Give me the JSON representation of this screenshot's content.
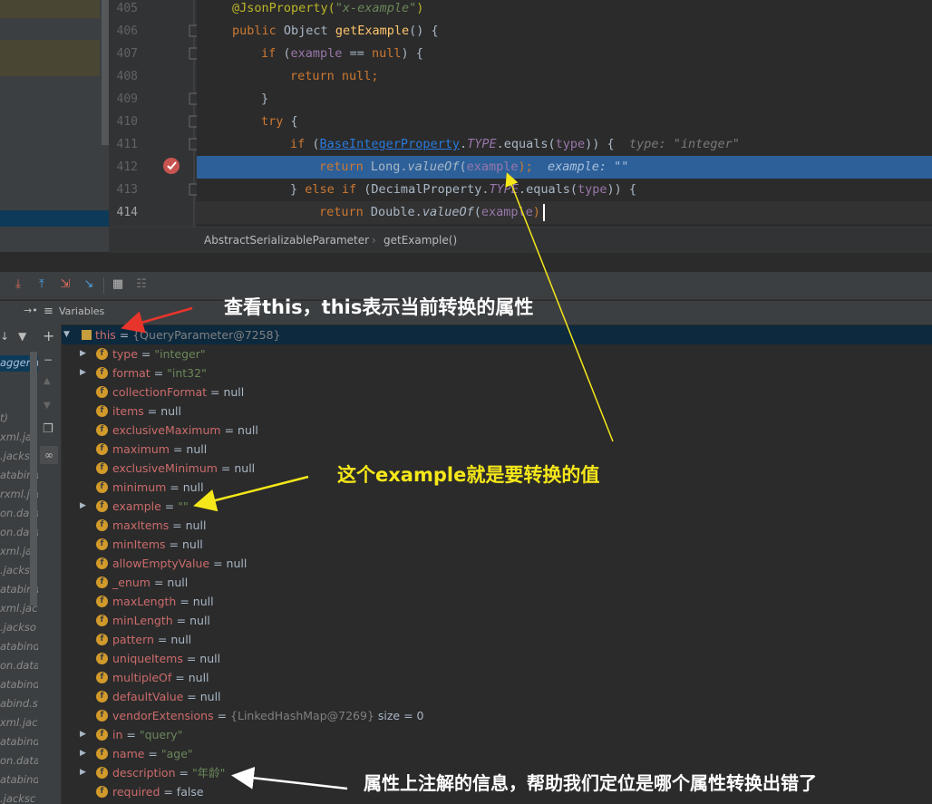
{
  "code": {
    "lines": [
      {
        "num": "405"
      },
      {
        "num": "406"
      },
      {
        "num": "407"
      },
      {
        "num": "408"
      },
      {
        "num": "409"
      },
      {
        "num": "410"
      },
      {
        "num": "411"
      },
      {
        "num": "412"
      },
      {
        "num": "413"
      },
      {
        "num": "414"
      }
    ],
    "l405": {
      "ann": "@JsonProperty(",
      "str": "\"x-example\"",
      "close": ")"
    },
    "l406": {
      "kw": "public ",
      "type": "Object ",
      "fn": "getExample",
      "rest": "() {"
    },
    "l407": {
      "kw": "if ",
      "rest1": "(",
      "field": "example",
      "rest2": " == ",
      "kw2": "null",
      "rest3": ") {"
    },
    "l408": {
      "kw": "return ",
      "kw2": "null",
      "rest": ";"
    },
    "l409": {
      "rest": "}"
    },
    "l410": {
      "kw": "try ",
      "rest": "{"
    },
    "l411": {
      "kw": "if ",
      "rest1": "(",
      "link": "BaseIntegerProperty",
      "dot": ".",
      "const": "TYPE",
      "rest2": ".equals(",
      "field": "type",
      "rest3": ")) {",
      "hint": "type: \"integer\""
    },
    "l412": {
      "kw": "return ",
      "cls": "Long.",
      "fn": "valueOf",
      "rest1": "(",
      "field": "example",
      "rest2": ");",
      "hint": "example: \"\""
    },
    "l413": {
      "rest1": "} ",
      "kw": "else if ",
      "rest2": "(DecimalProperty.",
      "const": "TYPE",
      "rest3": ".equals(",
      "field": "type",
      "rest4": ")) {"
    },
    "l414": {
      "kw": "return ",
      "cls": "Double.",
      "fn": "valueOf",
      "rest1": "(",
      "field": "example",
      "rest2": ");"
    }
  },
  "breadcrumb": {
    "class_name": "AbstractSerializableParameter",
    "separator": "›",
    "method": "getExample()"
  },
  "debug": {
    "variables_label": "Variables",
    "toolbar_icons": [
      "step-over-icon",
      "step-into-icon",
      "force-step-into-icon",
      "step-out-icon",
      "run-to-cursor-icon",
      "evaluate-icon",
      "trace-icon"
    ]
  },
  "frames": {
    "items": [
      "agger.m",
      "t)",
      "xml.jacks",
      ".jackso",
      "atabind.",
      "rxml.jac",
      "on.data",
      "on.data",
      "xml.jacks",
      ".jackso",
      "atabind.",
      "xml.jacks",
      ".jackso",
      "atabind.",
      "on.data",
      "atabind.",
      "abind.s",
      "xml.jacks",
      "atabind.",
      "on.data",
      "atabind.",
      ".jacksc"
    ]
  },
  "variables": {
    "this": {
      "name": "this",
      "eq": " = ",
      "value": "{QueryParameter@7258}"
    },
    "rows": [
      {
        "name": "type",
        "eq": " = ",
        "value": "\"integer\"",
        "kind": "str",
        "expand": true
      },
      {
        "name": "format",
        "eq": " = ",
        "value": "\"int32\"",
        "kind": "str",
        "expand": true
      },
      {
        "name": "collectionFormat",
        "eq": " = ",
        "value": "null",
        "kind": "null",
        "expand": false
      },
      {
        "name": "items",
        "eq": " = ",
        "value": "null",
        "kind": "null",
        "expand": false
      },
      {
        "name": "exclusiveMaximum",
        "eq": " = ",
        "value": "null",
        "kind": "null",
        "expand": false
      },
      {
        "name": "maximum",
        "eq": " = ",
        "value": "null",
        "kind": "null",
        "expand": false
      },
      {
        "name": "exclusiveMinimum",
        "eq": " = ",
        "value": "null",
        "kind": "null",
        "expand": false
      },
      {
        "name": "minimum",
        "eq": " = ",
        "value": "null",
        "kind": "null",
        "expand": false
      },
      {
        "name": "example",
        "eq": " = ",
        "value": "\"\"",
        "kind": "str",
        "expand": true
      },
      {
        "name": "maxItems",
        "eq": " = ",
        "value": "null",
        "kind": "null",
        "expand": false
      },
      {
        "name": "minItems",
        "eq": " = ",
        "value": "null",
        "kind": "null",
        "expand": false
      },
      {
        "name": "allowEmptyValue",
        "eq": " = ",
        "value": "null",
        "kind": "null",
        "expand": false
      },
      {
        "name": "_enum",
        "eq": " = ",
        "value": "null",
        "kind": "null",
        "expand": false
      },
      {
        "name": "maxLength",
        "eq": " = ",
        "value": "null",
        "kind": "null",
        "expand": false
      },
      {
        "name": "minLength",
        "eq": " = ",
        "value": "null",
        "kind": "null",
        "expand": false
      },
      {
        "name": "pattern",
        "eq": " = ",
        "value": "null",
        "kind": "null",
        "expand": false
      },
      {
        "name": "uniqueItems",
        "eq": " = ",
        "value": "null",
        "kind": "null",
        "expand": false
      },
      {
        "name": "multipleOf",
        "eq": " = ",
        "value": "null",
        "kind": "null",
        "expand": false
      },
      {
        "name": "defaultValue",
        "eq": " = ",
        "value": "null",
        "kind": "null",
        "expand": false
      },
      {
        "name": "vendorExtensions",
        "eq": " = ",
        "value": "{LinkedHashMap@7269}",
        "extra": "  size = 0",
        "kind": "obj",
        "expand": false
      },
      {
        "name": "in",
        "eq": " = ",
        "value": "\"query\"",
        "kind": "str",
        "expand": true
      },
      {
        "name": "name",
        "eq": " = ",
        "value": "\"age\"",
        "kind": "str",
        "expand": true
      },
      {
        "name": "description",
        "eq": " = ",
        "value": "\"年龄\"",
        "kind": "str",
        "expand": true
      },
      {
        "name": "required",
        "eq": " = ",
        "value": "false",
        "kind": "null",
        "expand": false
      }
    ]
  },
  "annotations": {
    "this_note": "查看this，this表示当前转换的属性",
    "example_note": "这个example就是要转换的值",
    "description_note": "属性上注解的信息，帮助我们定位是哪个属性转换出错了",
    "colors": {
      "red": "#e8352c",
      "yellow": "#f5e71a",
      "white": "#ffffff"
    }
  }
}
